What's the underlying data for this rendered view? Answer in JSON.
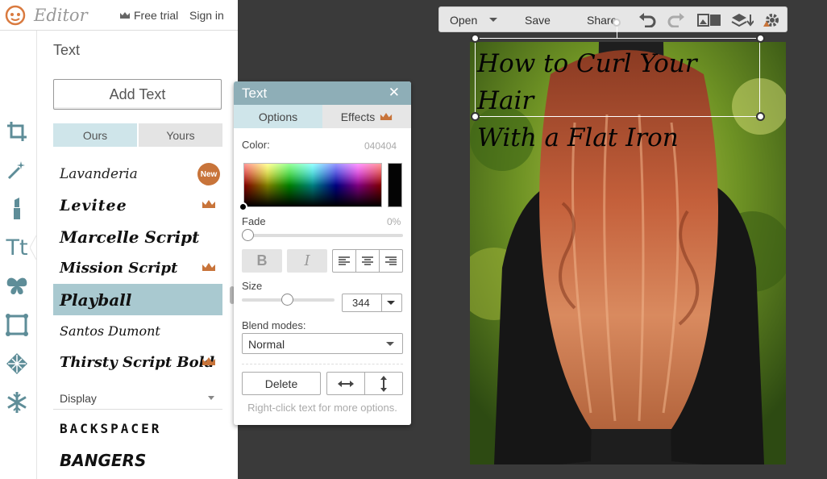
{
  "app": {
    "title": "Editor",
    "free_trial": "Free trial",
    "sign_in": "Sign in"
  },
  "panel": {
    "title": "Text",
    "add_text": "Add Text",
    "tabs": [
      "Ours",
      "Yours"
    ],
    "fonts": [
      {
        "name": "Lavanderia",
        "badge": "New"
      },
      {
        "name": "Levitee",
        "premium": true
      },
      {
        "name": "Marcelle Script"
      },
      {
        "name": "Mission Script",
        "premium": true
      },
      {
        "name": "Playball",
        "selected": true
      },
      {
        "name": "Santos Dumont"
      },
      {
        "name": "Thirsty Script Bold",
        "premium": true
      }
    ],
    "category": "Display",
    "fonts_display": [
      {
        "name": "BACKSPACER"
      },
      {
        "name": "BANGERS"
      }
    ]
  },
  "toolbar": {
    "open": "Open",
    "save": "Save",
    "share": "Share"
  },
  "canvas": {
    "overlay_text_line1": "How to Curl Your Hair",
    "overlay_text_line2": "With a Flat Iron"
  },
  "dialog": {
    "title": "Text",
    "tabs": [
      "Options",
      "Effects"
    ],
    "color_label": "Color:",
    "color_value": "040404",
    "fade_label": "Fade",
    "fade_value": "0%",
    "bold": "B",
    "italic": "I",
    "size_label": "Size",
    "size_value": "344",
    "blend_label": "Blend modes:",
    "blend_value": "Normal",
    "delete": "Delete",
    "hint": "Right-click text for more options."
  },
  "colors": {
    "accent": "#8eaeb7",
    "selected_font": "#a9c9d0",
    "tab_active": "#cfe5ea",
    "premium": "#c8743a",
    "text_color": "#040404"
  }
}
